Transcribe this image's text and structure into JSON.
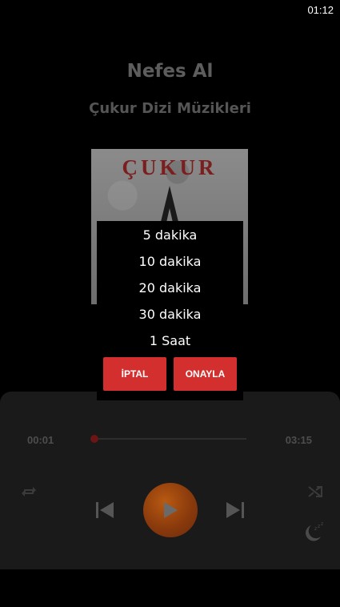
{
  "status_bar": {
    "time": "01:12"
  },
  "now_playing": {
    "title": "Nefes Al",
    "subtitle": "Çukur Dizi Müzikleri",
    "album_logo_text": "ÇUKUR"
  },
  "player": {
    "current_time": "00:01",
    "total_time": "03:15",
    "progress": 0.0,
    "accent_color": "#c2621a",
    "seek_color": "#6b1515"
  },
  "icons": {
    "repeat": "repeat-icon",
    "shuffle": "shuffle-icon",
    "previous": "skip-previous-icon",
    "play": "play-icon",
    "next": "skip-next-icon",
    "sleep": "moon-sleep-icon"
  },
  "sleep_dialog": {
    "options": [
      "5 dakika",
      "10 dakika",
      "20 dakika",
      "30 dakika",
      "1 Saat"
    ],
    "cancel_label": "İPTAL",
    "confirm_label": "ONAYLA",
    "button_color": "#d32f2f"
  }
}
